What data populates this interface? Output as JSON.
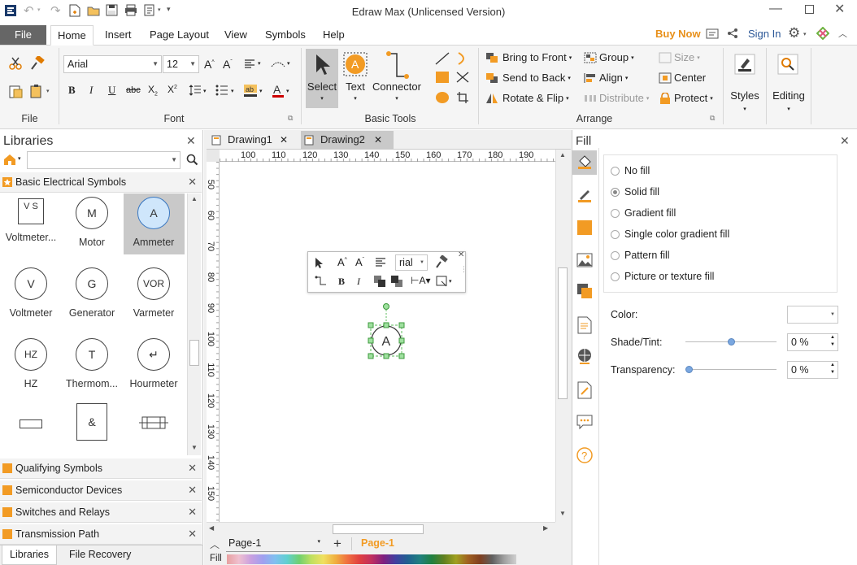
{
  "app": {
    "title": "Edraw Max (Unlicensed Version)"
  },
  "menu": {
    "file": "File",
    "tabs": [
      "Home",
      "Insert",
      "Page Layout",
      "View",
      "Symbols",
      "Help"
    ],
    "buy_now": "Buy Now",
    "sign_in": "Sign In"
  },
  "ribbon": {
    "file_group": "File",
    "font_group": "Font",
    "font_name": "Arial",
    "font_size": "12",
    "basic_tools_group": "Basic Tools",
    "select": "Select",
    "text": "Text",
    "connector": "Connector",
    "arrange_group": "Arrange",
    "bring_to_front": "Bring to Front",
    "send_to_back": "Send to Back",
    "rotate_flip": "Rotate & Flip",
    "group": "Group",
    "align": "Align",
    "distribute": "Distribute",
    "size": "Size",
    "center": "Center",
    "protect": "Protect",
    "styles": "Styles",
    "editing": "Editing"
  },
  "libraries": {
    "title": "Libraries",
    "category": "Basic Electrical Symbols",
    "symbols": [
      {
        "label": "Voltmeter...",
        "glyph": "V S"
      },
      {
        "label": "Motor",
        "glyph": "M"
      },
      {
        "label": "Ammeter",
        "glyph": "A"
      },
      {
        "label": "Voltmeter",
        "glyph": "V"
      },
      {
        "label": "Generator",
        "glyph": "G"
      },
      {
        "label": "Varmeter",
        "glyph": "VOR"
      },
      {
        "label": "HZ",
        "glyph": "HZ"
      },
      {
        "label": "Thermom...",
        "glyph": "T"
      },
      {
        "label": "Hourmeter",
        "glyph": "↵"
      },
      {
        "label": "",
        "glyph": ""
      },
      {
        "label": "",
        "glyph": "&"
      },
      {
        "label": "",
        "glyph": ""
      }
    ],
    "other_libraries": [
      "Qualifying Symbols",
      "Semiconductor Devices",
      "Switches and Relays",
      "Transmission Path"
    ],
    "bottom_tabs": [
      "Libraries",
      "File Recovery"
    ]
  },
  "documents": {
    "tabs": [
      "Drawing1",
      "Drawing2"
    ],
    "ruler_h": [
      "100",
      "110",
      "120",
      "130",
      "140",
      "150",
      "160",
      "170",
      "180",
      "190"
    ],
    "ruler_v": [
      "50",
      "60",
      "70",
      "80",
      "90",
      "100",
      "110",
      "120",
      "130",
      "140",
      "150"
    ],
    "mini_toolbar_font": "rial",
    "shape_glyph": "A",
    "page_select": "Page-1",
    "page_tab": "Page-1",
    "fill_label": "Fill"
  },
  "fill_panel": {
    "title": "Fill",
    "options": [
      "No fill",
      "Solid fill",
      "Gradient fill",
      "Single color gradient fill",
      "Pattern fill",
      "Picture or texture fill"
    ],
    "selected_index": 1,
    "color_label": "Color:",
    "shade_label": "Shade/Tint:",
    "shade_value": "0 %",
    "shade_level": 0.5,
    "transparency_label": "Transparency:",
    "transparency_value": "0 %",
    "transparency_level": 0
  },
  "colors": {
    "accent": "#F29B24",
    "selected_tile": "#C9C9C9",
    "handle_green": "#5DBB5D",
    "file_tab": "#666666"
  }
}
